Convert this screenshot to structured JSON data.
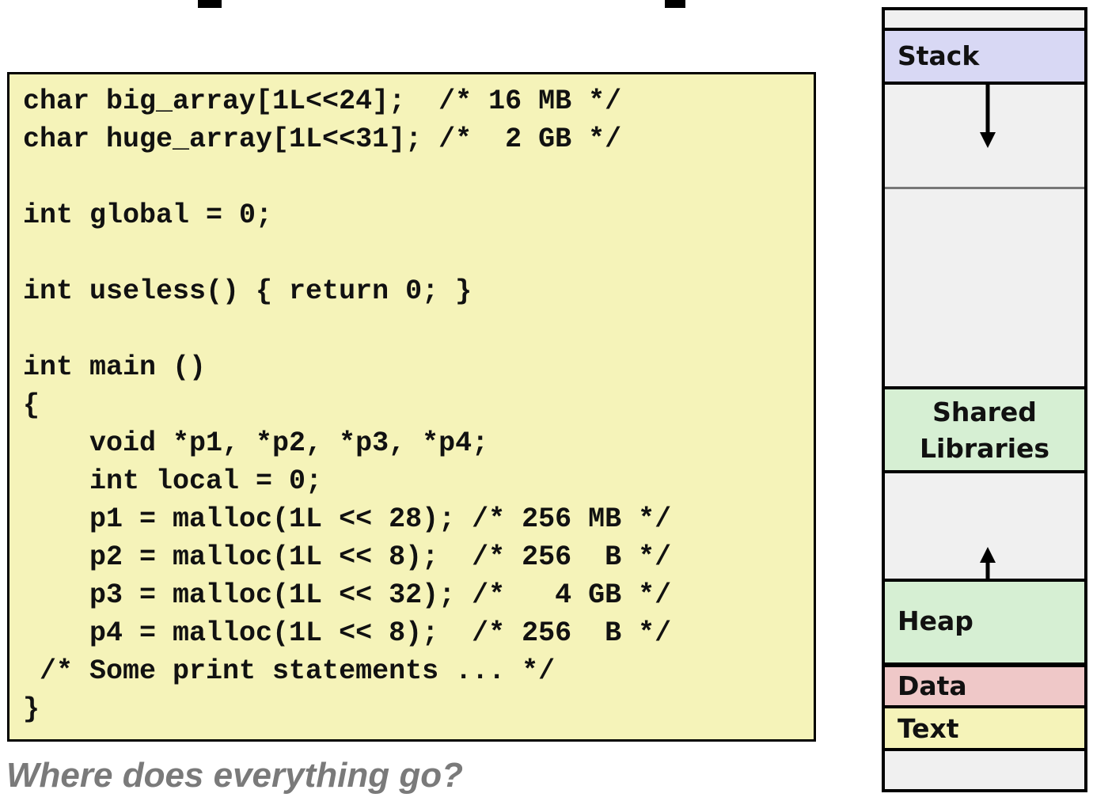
{
  "code": {
    "lines": [
      "char big_array[1L<<24];  /* 16 MB */",
      "char huge_array[1L<<31]; /*  2 GB */",
      "",
      "int global = 0;",
      "",
      "int useless() { return 0; }",
      "",
      "int main ()",
      "{",
      "    void *p1, *p2, *p3, *p4;",
      "    int local = 0;",
      "    p1 = malloc(1L << 28); /* 256 MB */",
      "    p2 = malloc(1L << 8);  /* 256  B */",
      "    p3 = malloc(1L << 32); /*   4 GB */",
      "    p4 = malloc(1L << 8);  /* 256  B */",
      " /* Some print statements ... */",
      "}"
    ]
  },
  "caption": "Where does everything go?",
  "memory": {
    "stack": "Stack",
    "shared_line1": "Shared",
    "shared_line2": "Libraries",
    "heap": "Heap",
    "data": "Data",
    "text": "Text"
  },
  "colors": {
    "code_bg": "#f5f3b9",
    "stack": "#d8d8f4",
    "shared": "#d6efd3",
    "heap": "#d6efd3",
    "data": "#efc8c8",
    "text": "#f5f3b9",
    "caption": "#7a7a7a"
  }
}
